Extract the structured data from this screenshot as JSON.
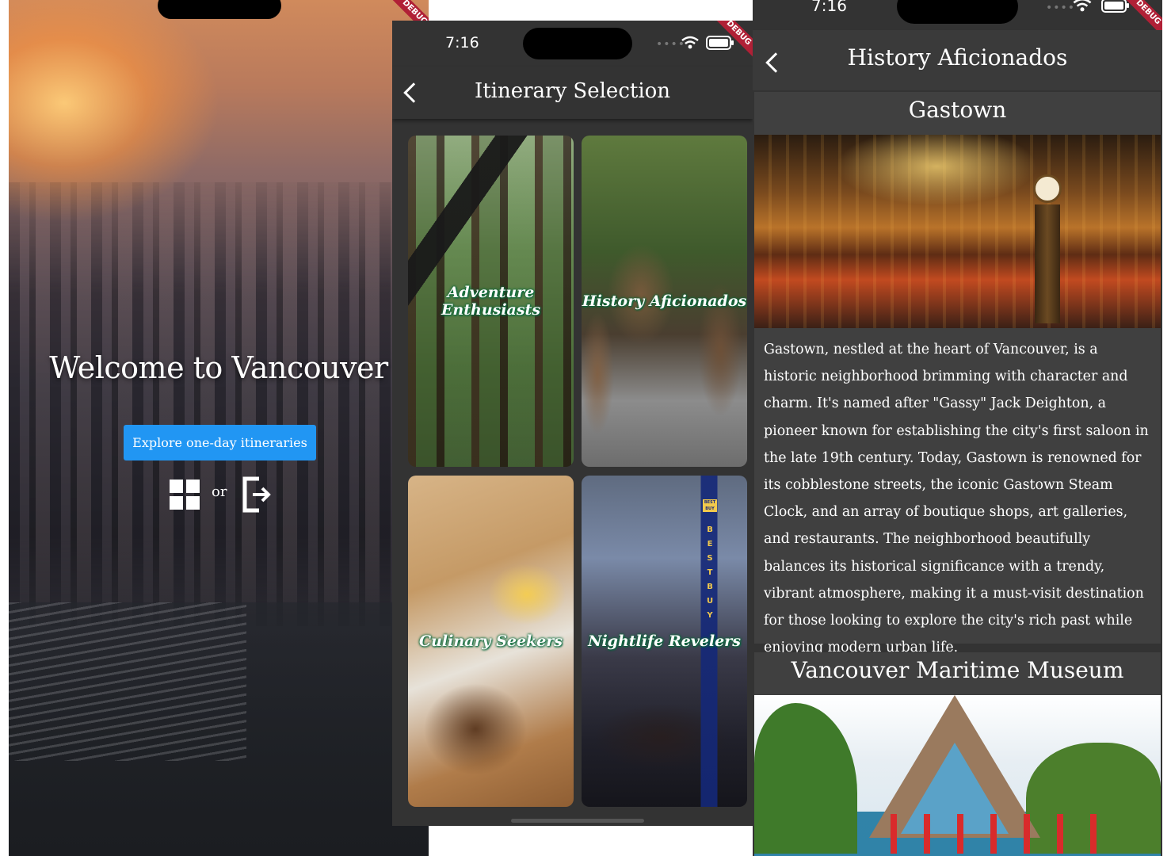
{
  "screen_welcome": {
    "title": "Welcome to Vancouver",
    "explore_button": "Explore one-day itineraries",
    "or_text": "or",
    "debug_banner": "DEBUG"
  },
  "screen_itinerary": {
    "status_time": "7:16",
    "title": "Itinerary Selection",
    "debug_banner": "DEBUG",
    "tiles": [
      {
        "label": "Adventure Enthusiasts"
      },
      {
        "label": "History Aficionados"
      },
      {
        "label": "Culinary Seekers"
      },
      {
        "label": "Nightlife Revelers"
      }
    ],
    "store_sign_letters": "BESTBUY",
    "store_sign_top": "BEST BUY"
  },
  "screen_history": {
    "status_time": "7:16",
    "title": "History Aficionados",
    "debug_banner": "DEBUG",
    "places": [
      {
        "name": "Gastown",
        "description": "Gastown, nestled at the heart of Vancouver, is a historic neighborhood brimming with character and charm. It's named after \"Gassy\" Jack Deighton, a pioneer known for establishing the city's first saloon in the late 19th century. Today, Gastown is renowned for its cobblestone streets, the iconic Gastown Steam Clock, and an array of boutique shops, art galleries, and restaurants. The neighborhood beautifully balances its historical significance with a trendy, vibrant atmosphere, making it a must-visit destination for those looking to explore the city's rich past while enjoying modern urban life."
      },
      {
        "name": "Vancouver Maritime Museum"
      }
    ]
  },
  "colors": {
    "primary_button": "#2196f3",
    "app_background": "#333333",
    "debug_banner": "#b02036",
    "tile_label_glow": "#0b6b3a"
  }
}
